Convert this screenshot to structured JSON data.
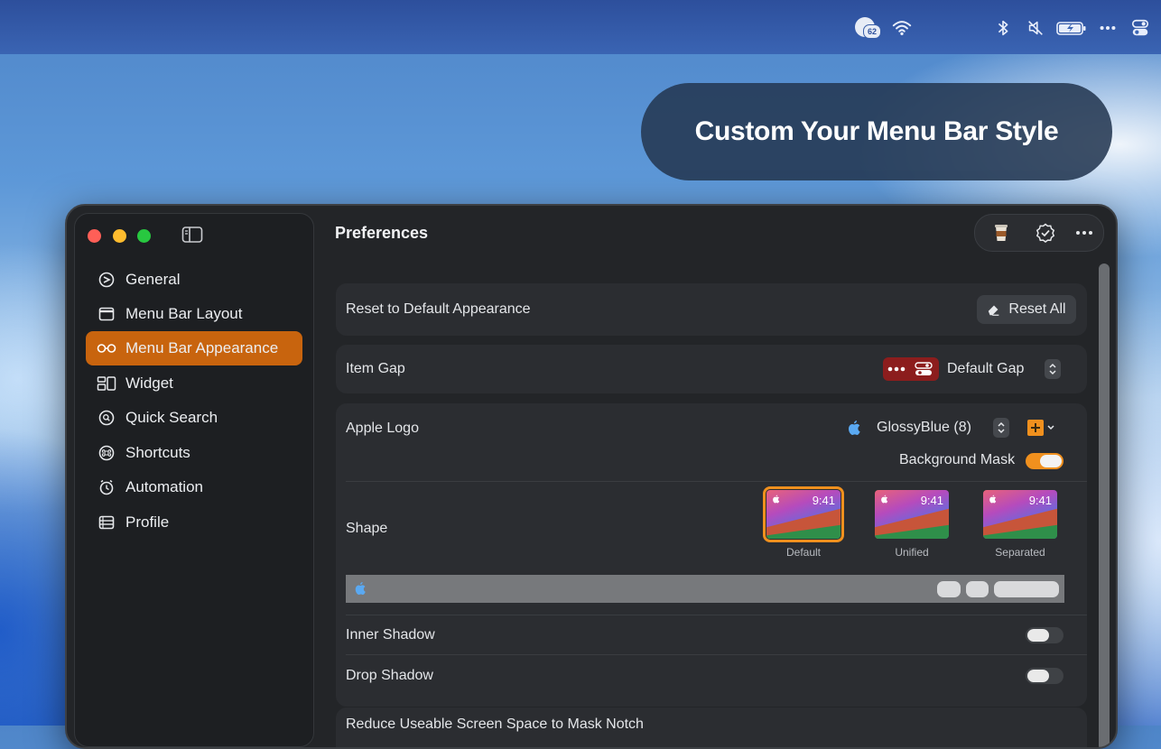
{
  "system_menubar": {
    "badge_count": "62",
    "items": [
      "badge-icon",
      "wifi-icon",
      "bluetooth-icon",
      "mute-icon",
      "battery-icon",
      "more-icon",
      "control-center-icon"
    ]
  },
  "callout": {
    "text": "Custom Your Menu Bar Style"
  },
  "window": {
    "title": "Preferences",
    "toolbar": [
      "coffee-icon",
      "verified-icon",
      "more-icon"
    ]
  },
  "sidebar": {
    "items": [
      {
        "label": "General",
        "icon": "general-icon"
      },
      {
        "label": "Menu Bar Layout",
        "icon": "window-icon"
      },
      {
        "label": "Menu Bar Appearance",
        "icon": "glasses-icon",
        "active": true
      },
      {
        "label": "Widget",
        "icon": "widget-icon"
      },
      {
        "label": "Quick Search",
        "icon": "search-icon"
      },
      {
        "label": "Shortcuts",
        "icon": "command-icon"
      },
      {
        "label": "Automation",
        "icon": "automation-icon"
      },
      {
        "label": "Profile",
        "icon": "profile-icon"
      }
    ]
  },
  "settings": {
    "reset": {
      "label": "Reset to Default Appearance",
      "button": "Reset All"
    },
    "item_gap": {
      "label": "Item Gap",
      "value": "Default Gap"
    },
    "apple_logo": {
      "label": "Apple Logo",
      "value": "GlossyBlue (8)",
      "accent_color": "#f0901e",
      "background_mask_label": "Background Mask",
      "background_mask_on": true
    },
    "shape": {
      "label": "Shape",
      "options": [
        {
          "caption": "Default",
          "time": "9:41",
          "selected": true
        },
        {
          "caption": "Unified",
          "time": "9:41",
          "selected": false
        },
        {
          "caption": "Separated",
          "time": "9:41",
          "selected": false
        }
      ]
    },
    "inner_shadow": {
      "label": "Inner Shadow",
      "on": false
    },
    "drop_shadow": {
      "label": "Drop Shadow",
      "on": false
    },
    "reduce_space": {
      "label": "Reduce Useable Screen Space to Mask Notch"
    }
  },
  "colors": {
    "accent": "#c8640e",
    "toggle_on": "#f0901e",
    "gap_chip": "#8c1d1d"
  }
}
